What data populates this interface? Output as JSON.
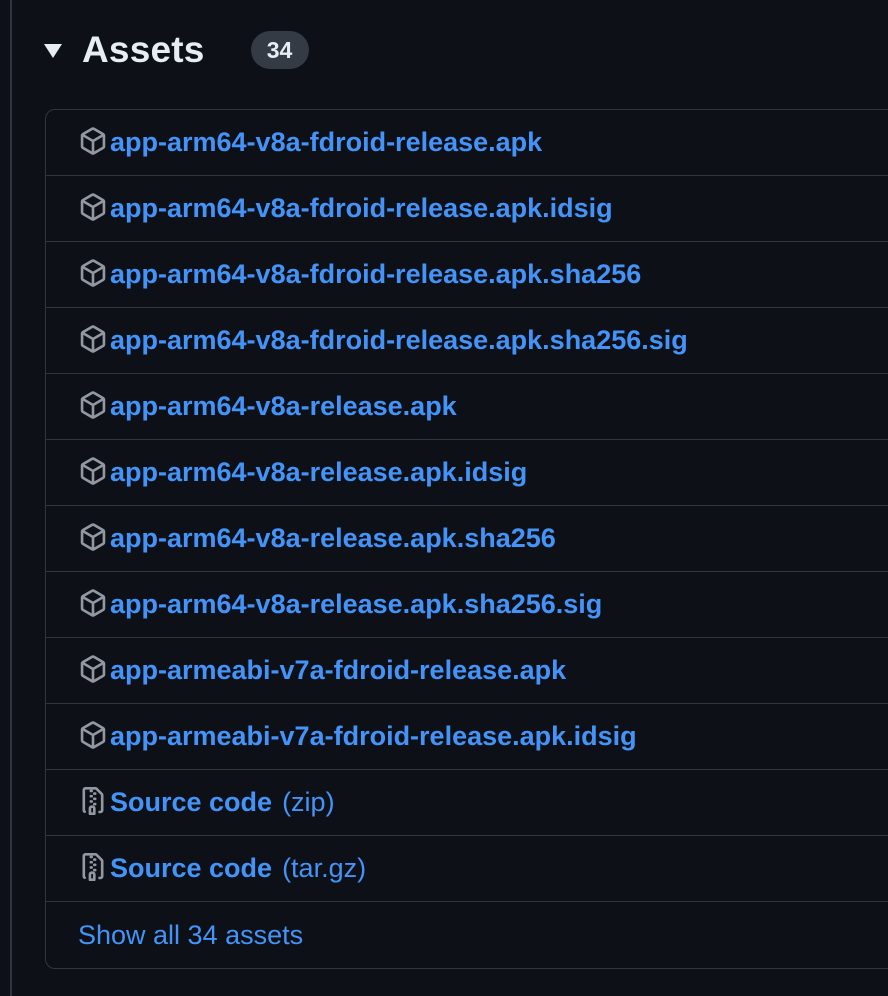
{
  "assets": {
    "title": "Assets",
    "count": "34",
    "items": [
      {
        "label": "app-arm64-v8a-fdroid-release.apk",
        "icon": "package-icon"
      },
      {
        "label": "app-arm64-v8a-fdroid-release.apk.idsig",
        "icon": "package-icon"
      },
      {
        "label": "app-arm64-v8a-fdroid-release.apk.sha256",
        "icon": "package-icon"
      },
      {
        "label": "app-arm64-v8a-fdroid-release.apk.sha256.sig",
        "icon": "package-icon"
      },
      {
        "label": "app-arm64-v8a-release.apk",
        "icon": "package-icon"
      },
      {
        "label": "app-arm64-v8a-release.apk.idsig",
        "icon": "package-icon"
      },
      {
        "label": "app-arm64-v8a-release.apk.sha256",
        "icon": "package-icon"
      },
      {
        "label": "app-arm64-v8a-release.apk.sha256.sig",
        "icon": "package-icon"
      },
      {
        "label": "app-armeabi-v7a-fdroid-release.apk",
        "icon": "package-icon"
      },
      {
        "label": "app-armeabi-v7a-fdroid-release.apk.idsig",
        "icon": "package-icon"
      }
    ],
    "source": [
      {
        "label": "Source code",
        "suffix": "(zip)",
        "icon": "file-zip-icon"
      },
      {
        "label": "Source code",
        "suffix": "(tar.gz)",
        "icon": "file-zip-icon"
      }
    ],
    "show_all": "Show all 34 assets"
  },
  "colors": {
    "background": "#0d1117",
    "border": "#30363d",
    "link": "#4493f8",
    "text": "#e6edf3",
    "badge_bg": "#343b45",
    "icon": "#9198a1"
  }
}
